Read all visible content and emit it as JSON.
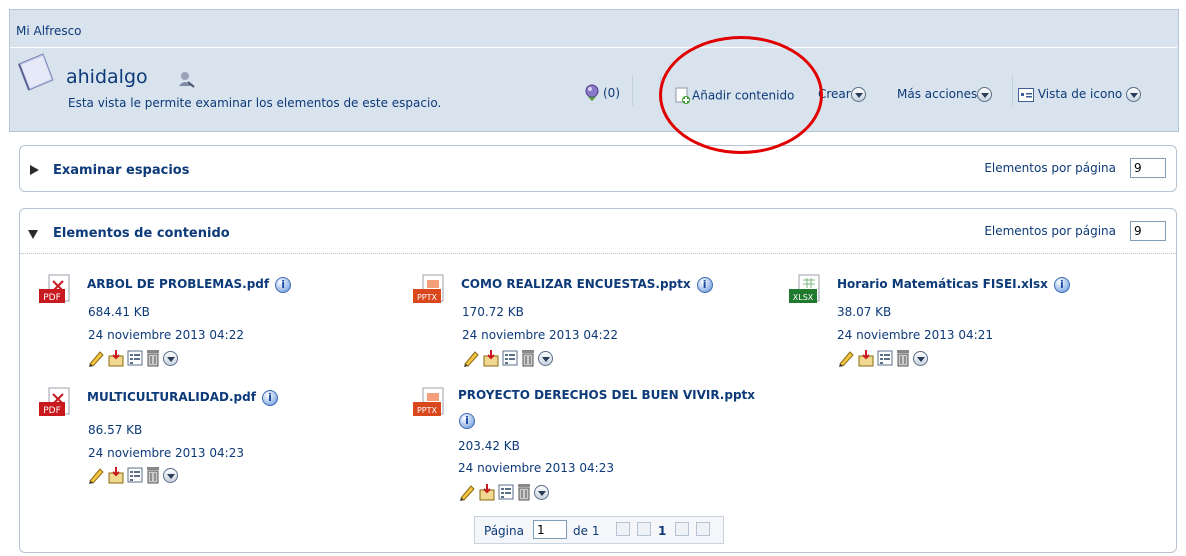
{
  "breadcrumb": "Mi Alfresco",
  "space": {
    "name": "ahidalgo",
    "description": "Esta vista le permite examinar los elementos de este espacio."
  },
  "toolbar": {
    "rules_count": "(0)",
    "add_content": "Añadir contenido",
    "create": "Crear",
    "more_actions": "Más acciones",
    "view": "Vista de icono"
  },
  "spaces_panel": {
    "title": "Examinar espacios",
    "per_page_label": "Elementos por página",
    "per_page_value": "9"
  },
  "content_panel": {
    "title": "Elementos de contenido",
    "per_page_label": "Elementos por página",
    "per_page_value": "9",
    "items": [
      {
        "name": "ARBOL DE PROBLEMAS.pdf",
        "type": "PDF",
        "size": "684.41 KB",
        "date": "24 noviembre 2013 04:22"
      },
      {
        "name": "COMO REALIZAR ENCUESTAS.pptx",
        "type": "PPTX",
        "size": "170.72 KB",
        "date": "24 noviembre 2013 04:22"
      },
      {
        "name": "Horario Matemáticas FISEI.xlsx",
        "type": "XLSX",
        "size": "38.07 KB",
        "date": "24 noviembre 2013 04:21"
      },
      {
        "name": "MULTICULTURALIDAD.pdf",
        "type": "PDF",
        "size": "86.57 KB",
        "date": "24 noviembre 2013 04:23"
      },
      {
        "name": "PROYECTO DERECHOS DEL BUEN VIVIR.pptx",
        "type": "PPTX",
        "size": "203.42 KB",
        "date": "24 noviembre 2013 04:23"
      }
    ]
  },
  "pager": {
    "label": "Página",
    "value": "1",
    "of": "de 1",
    "current": "1"
  },
  "colors": {
    "accent_link": "#0d3a78",
    "header_bg": "#d9e3ee",
    "highlight_circle": "#e00000",
    "pdf": "#c8191e",
    "pptx": "#d9471c",
    "xlsx": "#1f7a2e"
  },
  "icons": [
    "space-icon",
    "user-icon",
    "rules-icon",
    "add-content-icon",
    "view-icon",
    "info-icon",
    "edit-icon",
    "checkout-icon",
    "details-icon",
    "delete-icon",
    "more-actions-icon"
  ]
}
